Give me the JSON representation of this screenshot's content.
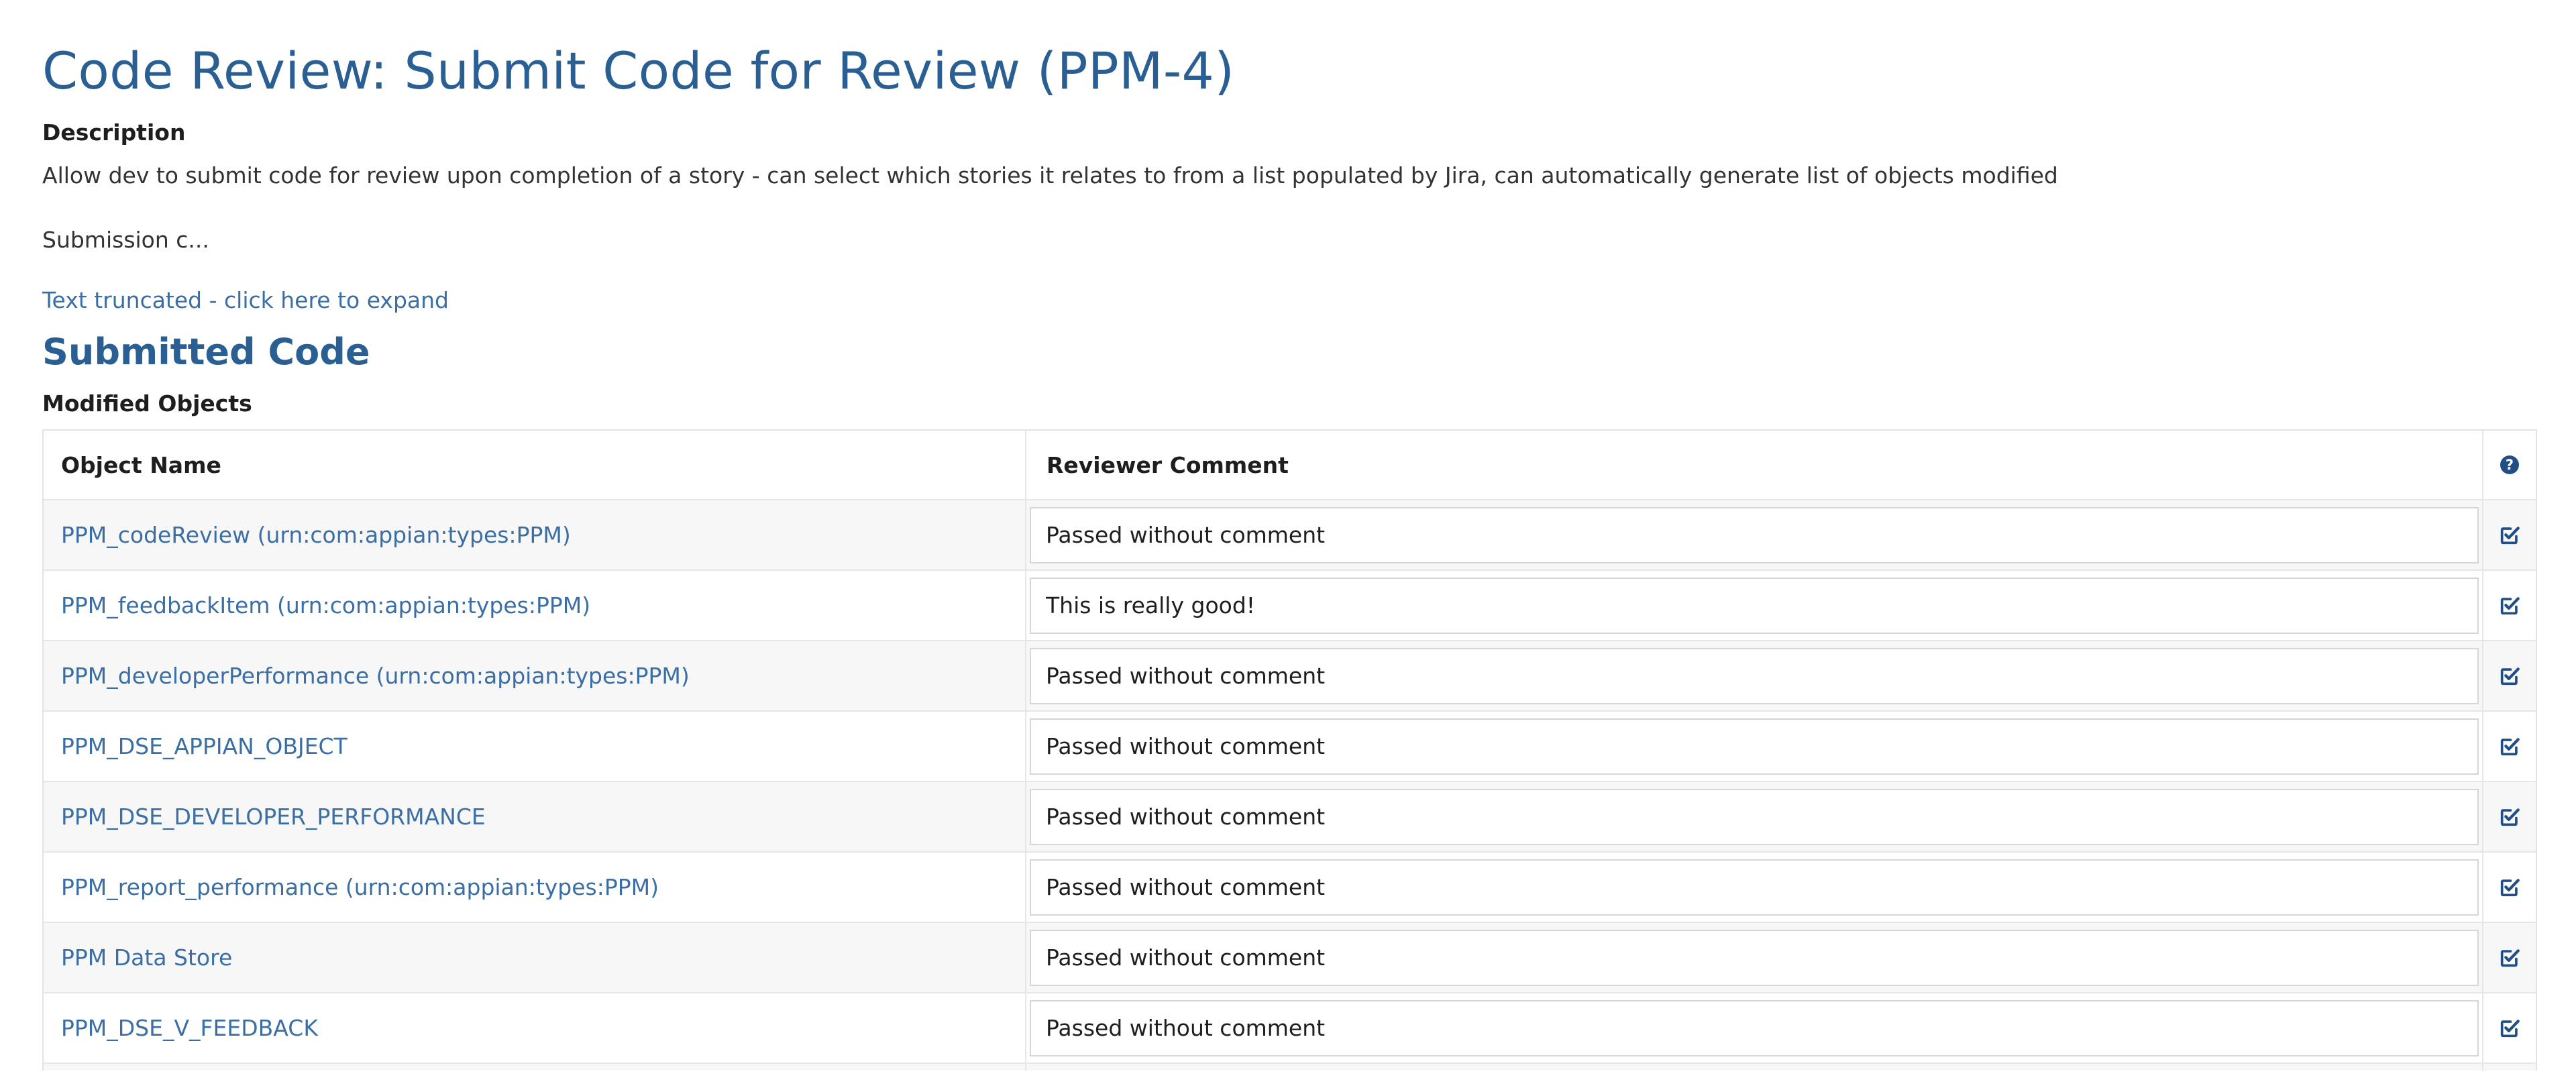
{
  "page": {
    "title": "Code Review: Submit Code for Review (PPM-4)"
  },
  "description": {
    "label": "Description",
    "text": "Allow dev to submit code for review upon completion of a story - can select which stories it relates to from a list populated by Jira, can automatically generate list of objects modified",
    "truncated_text": "Submission c...",
    "expand_link": "Text truncated - click here to expand"
  },
  "submitted_code": {
    "section_title": "Submitted Code",
    "grid_label": "Modified Objects",
    "columns": {
      "object_name": "Object Name",
      "reviewer_comment": "Reviewer Comment",
      "action_icon": "help-icon"
    },
    "rows": [
      {
        "object_name": "PPM_codeReview (urn:com:appian:types:PPM)",
        "reviewer_comment": "Passed without comment",
        "action_icon": "checkbox-edit-icon"
      },
      {
        "object_name": "PPM_feedbackItem (urn:com:appian:types:PPM)",
        "reviewer_comment": "This is really good!",
        "action_icon": "checkbox-edit-icon"
      },
      {
        "object_name": "PPM_developerPerformance (urn:com:appian:types:PPM)",
        "reviewer_comment": "Passed without comment",
        "action_icon": "checkbox-edit-icon"
      },
      {
        "object_name": "PPM_DSE_APPIAN_OBJECT",
        "reviewer_comment": "Passed without comment",
        "action_icon": "checkbox-edit-icon"
      },
      {
        "object_name": "PPM_DSE_DEVELOPER_PERFORMANCE",
        "reviewer_comment": "Passed without comment",
        "action_icon": "checkbox-edit-icon"
      },
      {
        "object_name": "PPM_report_performance (urn:com:appian:types:PPM)",
        "reviewer_comment": "Passed without comment",
        "action_icon": "checkbox-edit-icon"
      },
      {
        "object_name": "PPM Data Store",
        "reviewer_comment": "Passed without comment",
        "action_icon": "checkbox-edit-icon"
      },
      {
        "object_name": "PPM_DSE_V_FEEDBACK",
        "reviewer_comment": "Passed without comment",
        "action_icon": "checkbox-edit-icon"
      }
    ]
  },
  "colors": {
    "title": "#2a5f94",
    "link": "#3a6ea5",
    "icon": "#1f4f86"
  }
}
